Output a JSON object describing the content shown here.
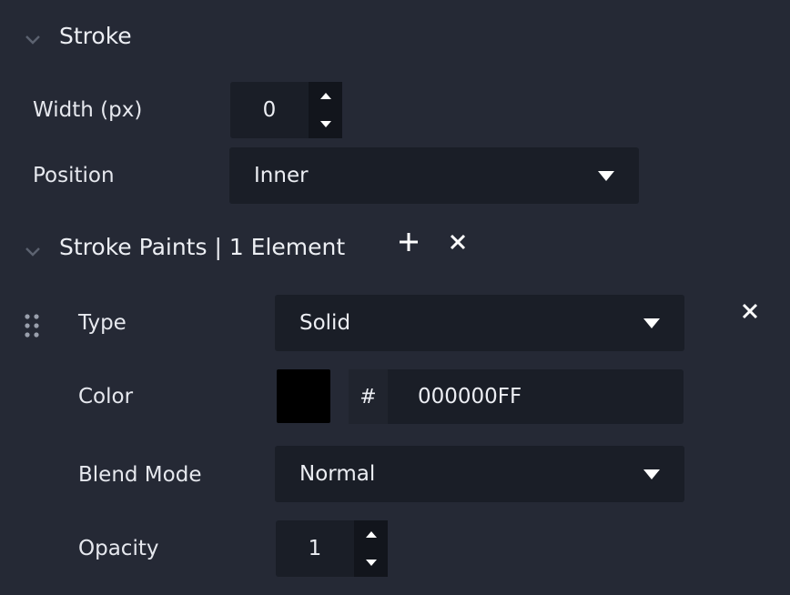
{
  "stroke": {
    "title": "Stroke",
    "width_label": "Width (px)",
    "width_value": "0",
    "position_label": "Position",
    "position_value": "Inner"
  },
  "stroke_paints": {
    "title": "Stroke Paints | 1 Element",
    "add_icon": "plus-icon",
    "clear_icon": "close-icon",
    "items": [
      {
        "type_label": "Type",
        "type_value": "Solid",
        "color_label": "Color",
        "color_hash": "#",
        "color_value": "000000FF",
        "color_swatch": "#000000",
        "blend_label": "Blend Mode",
        "blend_value": "Normal",
        "opacity_label": "Opacity",
        "opacity_value": "1"
      }
    ]
  },
  "colors": {
    "background": "#252935",
    "field": "#1a1e27",
    "text": "#e6e8ee",
    "icon": "#ffffff"
  }
}
